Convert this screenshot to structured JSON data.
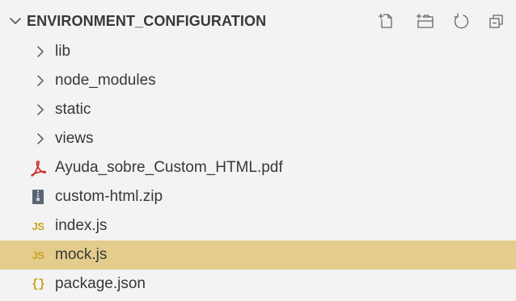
{
  "explorer": {
    "section_title": "ENVIRONMENT_CONFIGURATION",
    "actions": [
      {
        "name": "new-file"
      },
      {
        "name": "new-folder"
      },
      {
        "name": "refresh"
      },
      {
        "name": "collapse-all"
      }
    ],
    "items": [
      {
        "type": "folder",
        "label": "lib",
        "icon": "chevron-right-icon"
      },
      {
        "type": "folder",
        "label": "node_modules",
        "icon": "chevron-right-icon"
      },
      {
        "type": "folder",
        "label": "static",
        "icon": "chevron-right-icon"
      },
      {
        "type": "folder",
        "label": "views",
        "icon": "chevron-right-icon"
      },
      {
        "type": "file",
        "label": "Ayuda_sobre_Custom_HTML.pdf",
        "icon": "pdf-icon",
        "icon_color": "#d0312d"
      },
      {
        "type": "file",
        "label": "custom-html.zip",
        "icon": "zip-icon",
        "icon_color": "#5a6673"
      },
      {
        "type": "file",
        "label": "index.js",
        "icon": "js-icon",
        "icon_text": "JS",
        "icon_color": "#c9a227"
      },
      {
        "type": "file",
        "label": "mock.js",
        "icon": "js-icon",
        "icon_text": "JS",
        "icon_color": "#c9a227",
        "selected": true
      },
      {
        "type": "file",
        "label": "package.json",
        "icon": "json-icon",
        "icon_text": "{}",
        "icon_color": "#c9a227"
      }
    ],
    "colors": {
      "background": "#f3f3f3",
      "selected_row": "#e4cd8c",
      "text": "#383838",
      "icon_gray": "#6b6b6b"
    }
  }
}
